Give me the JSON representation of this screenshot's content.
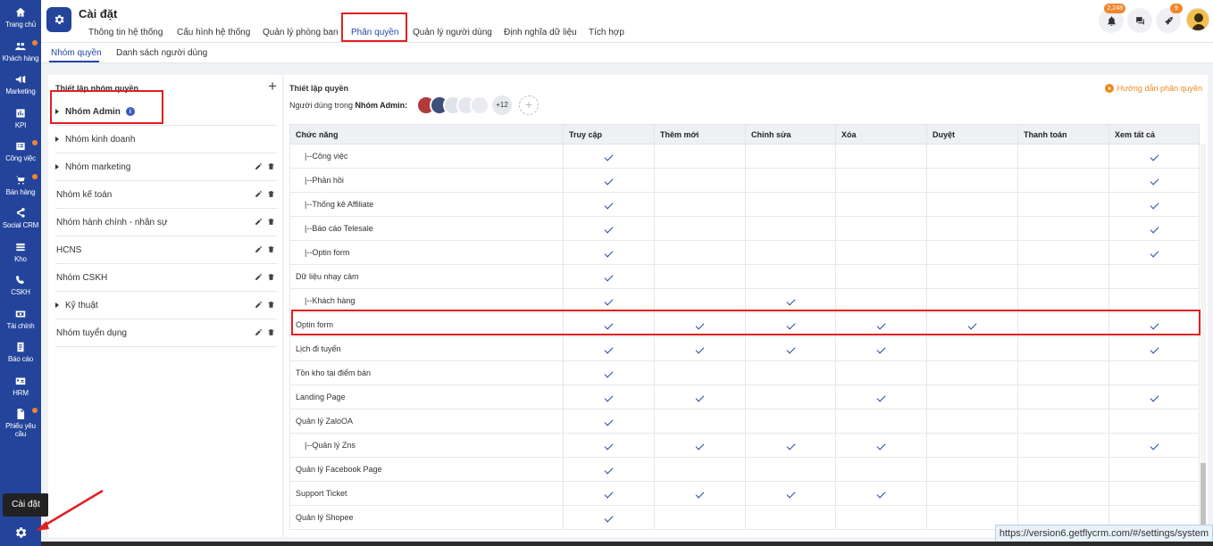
{
  "sidebar": {
    "items": [
      {
        "label": "Trang chủ",
        "icon": "home-icon",
        "dot": false
      },
      {
        "label": "Khách hàng",
        "icon": "customers-icon",
        "dot": true
      },
      {
        "label": "Marketing",
        "icon": "megaphone-icon",
        "dot": false
      },
      {
        "label": "KPI",
        "icon": "kpi-icon",
        "dot": false
      },
      {
        "label": "Công việc",
        "icon": "tasks-icon",
        "dot": true
      },
      {
        "label": "Bán hàng",
        "icon": "cart-icon",
        "dot": true
      },
      {
        "label": "Social CRM",
        "icon": "share-icon",
        "dot": false
      },
      {
        "label": "Kho",
        "icon": "warehouse-icon",
        "dot": false
      },
      {
        "label": "CSKH",
        "icon": "phone-icon",
        "dot": false
      },
      {
        "label": "Tài chính",
        "icon": "finance-icon",
        "dot": false
      },
      {
        "label": "Báo cáo",
        "icon": "report-icon",
        "dot": false
      },
      {
        "label": "HRM",
        "icon": "hrm-icon",
        "dot": false
      },
      {
        "label": "Phiếu yêu cầu",
        "icon": "request-icon",
        "dot": true
      }
    ],
    "settings_tooltip": "Cài đặt"
  },
  "header": {
    "title": "Cài đặt",
    "tabs": [
      "Thông tin hệ thống",
      "Cấu hình hệ thống",
      "Quản lý phòng ban",
      "Phân quyền",
      "Quản lý người dùng",
      "Định nghĩa dữ liệu",
      "Tích hợp"
    ],
    "active_tab": "Phân quyền",
    "notification_badge": "2,248",
    "rocket_badge": "9"
  },
  "subtabs": [
    "Nhóm quyền",
    "Danh sách người dùng"
  ],
  "groups_panel": {
    "title": "Thiết lập nhóm quyền",
    "add": "+",
    "groups": [
      {
        "name": "Nhóm Admin",
        "arrow": true,
        "info": true,
        "actions": false
      },
      {
        "name": "Nhóm kinh doanh",
        "arrow": true,
        "info": false,
        "actions": false
      },
      {
        "name": "Nhóm marketing",
        "arrow": true,
        "info": false,
        "actions": true
      },
      {
        "name": "Nhóm kế toán",
        "arrow": false,
        "info": false,
        "actions": true
      },
      {
        "name": "Nhóm hành chính - nhân sự",
        "arrow": false,
        "info": false,
        "actions": true
      },
      {
        "name": "HCNS",
        "arrow": false,
        "info": false,
        "actions": true
      },
      {
        "name": "Nhóm CSKH",
        "arrow": false,
        "info": false,
        "actions": true
      },
      {
        "name": "Kỹ thuật",
        "arrow": true,
        "info": false,
        "actions": true
      },
      {
        "name": "Nhóm tuyển dụng",
        "arrow": false,
        "info": false,
        "actions": true
      }
    ],
    "info_icon": "i"
  },
  "permissions": {
    "title": "Thiết lập quyền",
    "users_label": "Người dùng trong",
    "group_name": "Nhóm Admin:",
    "more_users": "+12",
    "help_link": "Hướng dẫn phân quyền",
    "columns": [
      "Chức năng",
      "Truy cập",
      "Thêm mới",
      "Chỉnh sửa",
      "Xóa",
      "Duyệt",
      "Thanh toán",
      "Xem tất cả"
    ],
    "rows": [
      {
        "name": "|--Công việc",
        "checks": [
          1,
          0,
          0,
          0,
          0,
          0,
          1
        ]
      },
      {
        "name": "|--Phản hồi",
        "checks": [
          1,
          0,
          0,
          0,
          0,
          0,
          1
        ]
      },
      {
        "name": "|--Thống kê Affiliate",
        "checks": [
          1,
          0,
          0,
          0,
          0,
          0,
          1
        ]
      },
      {
        "name": "|--Báo cáo Telesale",
        "checks": [
          1,
          0,
          0,
          0,
          0,
          0,
          1
        ]
      },
      {
        "name": "|--Optin form",
        "checks": [
          1,
          0,
          0,
          0,
          0,
          0,
          1
        ]
      },
      {
        "name": "Dữ liệu nhạy cảm",
        "checks": [
          1,
          0,
          0,
          0,
          0,
          0,
          0
        ]
      },
      {
        "name": "|--Khách hàng",
        "checks": [
          1,
          0,
          1,
          0,
          0,
          0,
          0
        ]
      },
      {
        "name": "Optin form",
        "checks": [
          1,
          1,
          1,
          1,
          1,
          0,
          1
        ]
      },
      {
        "name": "Lịch đi tuyến",
        "checks": [
          1,
          1,
          1,
          1,
          0,
          0,
          1
        ]
      },
      {
        "name": "Tồn kho tại điểm bán",
        "checks": [
          1,
          0,
          0,
          0,
          0,
          0,
          0
        ]
      },
      {
        "name": "Landing Page",
        "checks": [
          1,
          1,
          0,
          1,
          0,
          0,
          1
        ]
      },
      {
        "name": "Quản lý ZaloOA",
        "checks": [
          1,
          0,
          0,
          0,
          0,
          0,
          0
        ]
      },
      {
        "name": "|--Quản lý Zns",
        "checks": [
          1,
          1,
          1,
          1,
          0,
          0,
          1
        ]
      },
      {
        "name": "Quản lý Facebook Page",
        "checks": [
          1,
          0,
          0,
          0,
          0,
          0,
          0
        ]
      },
      {
        "name": "Support Ticket",
        "checks": [
          1,
          1,
          1,
          1,
          0,
          0,
          0
        ]
      },
      {
        "name": "Quản lý Shopee",
        "checks": [
          1,
          0,
          0,
          0,
          0,
          0,
          0
        ]
      }
    ]
  },
  "status_url": "https://version6.getflycrm.com/#/settings/system",
  "colors": {
    "sidebar": "#23449a",
    "accent": "#2447a8",
    "highlight": "#e02020",
    "badge": "#f0862d",
    "help": "#f08a1c"
  }
}
